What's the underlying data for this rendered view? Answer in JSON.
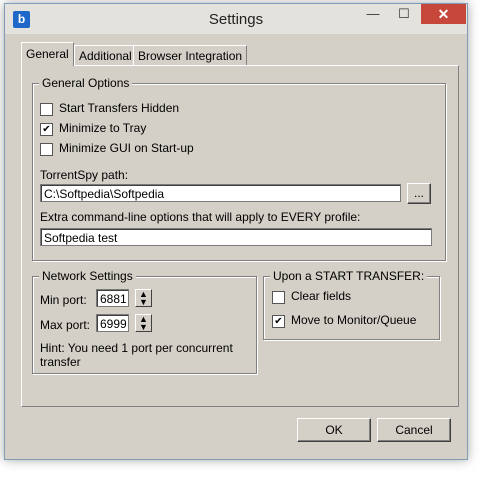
{
  "window": {
    "title": "Settings",
    "icon": "app-logo-icon",
    "close_glyph": "✕",
    "minimize_glyph": "—",
    "maximize_glyph": "☐"
  },
  "tabs": [
    {
      "label": "General",
      "active": true
    },
    {
      "label": "Additional",
      "active": false
    },
    {
      "label": "Browser Integration",
      "active": false
    }
  ],
  "general_options": {
    "legend": "General Options",
    "checkboxes": [
      {
        "label": "Start Transfers Hidden",
        "checked": false
      },
      {
        "label": "Minimize to Tray",
        "checked": true
      },
      {
        "label": "Minimize GUI on Start-up",
        "checked": false
      }
    ],
    "path_label": "TorrentSpy path:",
    "path_value": "C:\\Softpedia\\Softpedia",
    "browse_label": "...",
    "extra_label": "Extra command-line options that will apply to EVERY profile:",
    "extra_value": "Softpedia test"
  },
  "network": {
    "legend": "Network Settings",
    "min_port_label": "Min port:",
    "min_port_value": "6881",
    "max_port_label": "Max port:",
    "max_port_value": "6999",
    "hint": "Hint: You need 1 port per concurrent transfer"
  },
  "start_transfer": {
    "legend": "Upon a START TRANSFER:",
    "checkboxes": [
      {
        "label": "Clear fields",
        "checked": false
      },
      {
        "label": "Move to Monitor/Queue",
        "checked": true
      }
    ]
  },
  "buttons": {
    "ok": "OK",
    "cancel": "Cancel"
  },
  "check_glyph": "✔"
}
